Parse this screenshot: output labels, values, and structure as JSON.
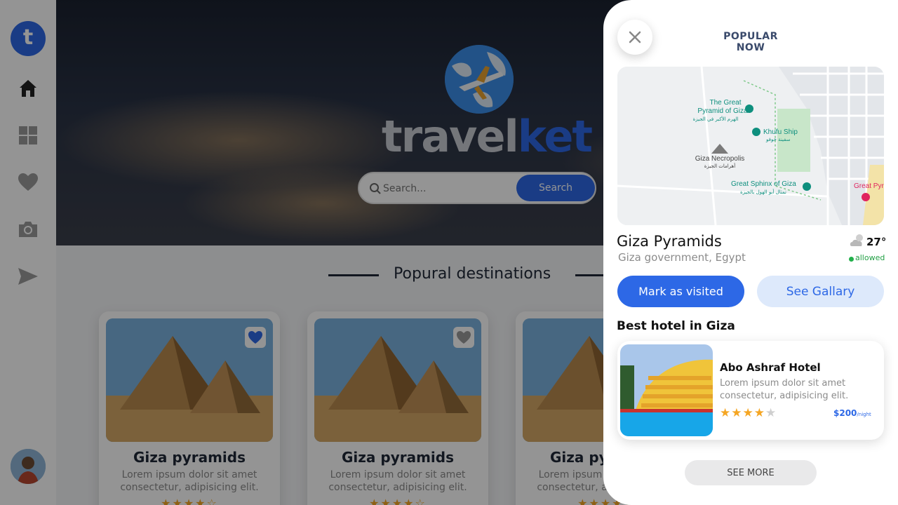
{
  "app": {
    "logo_letter": "t",
    "logo_text_a": "travel",
    "logo_text_b": "ket"
  },
  "sidebar": {
    "items": [
      {
        "icon": "home-icon"
      },
      {
        "icon": "grid-icon"
      },
      {
        "icon": "heart-icon"
      },
      {
        "icon": "camera-icon"
      },
      {
        "icon": "send-icon"
      }
    ]
  },
  "search": {
    "placeholder": "Search...",
    "button_label": "Search"
  },
  "section": {
    "title": "Popural destinations"
  },
  "cards": [
    {
      "title": "Giza pyramids",
      "desc": "Lorem ipsum dolor sit amet consectetur, adipisicing elit.",
      "stars": "★★★★☆"
    },
    {
      "title": "Giza pyramids",
      "desc": "Lorem ipsum dolor sit amet consectetur, adipisicing elit.",
      "stars": "★★★★☆"
    },
    {
      "title": "Giza pyramids",
      "desc": "Lorem ipsum dolor sit amet consectetur, adipisicing elit.",
      "stars": "★★★★☆"
    }
  ],
  "panel": {
    "title": "POPULAR NOW",
    "map_labels": {
      "great_pyramid_en_1": "The Great",
      "great_pyramid_en_2": "Pyramid of Giza",
      "great_pyramid_ar": "الهرم الأكبر في الجيزة",
      "khufu_en": "Khufu Ship",
      "khufu_ar": "سفينة خوفو",
      "necropolis_en": "Giza Necropolis",
      "necropolis_ar": "أهرامات الجيزة",
      "sphinx_en": "Great Sphinx of Giza",
      "sphinx_ar": "تمثال أبو الهول بالجيزة",
      "edge_label": "Great Pyr"
    },
    "place_name": "Giza Pyramids",
    "place_sub": "Giza government, Egypt",
    "temperature": "27°",
    "status": "allowed",
    "btn_visited": "Mark as visited",
    "btn_gallery": "See Gallary",
    "best_title": "Best hotel in Giza",
    "hotel": {
      "name": "Abo Ashraf Hotel",
      "desc": "Lorem ipsum dolor sit amet consectetur, adipisicing elit.",
      "rating": 4,
      "stars_on": "★★★★",
      "stars_off": "★",
      "price": "$200",
      "price_unit": "/night"
    },
    "see_more": "SEE MORE"
  },
  "colors": {
    "accent": "#2d68e6",
    "star": "#f5a623",
    "status": "#22b04b"
  }
}
